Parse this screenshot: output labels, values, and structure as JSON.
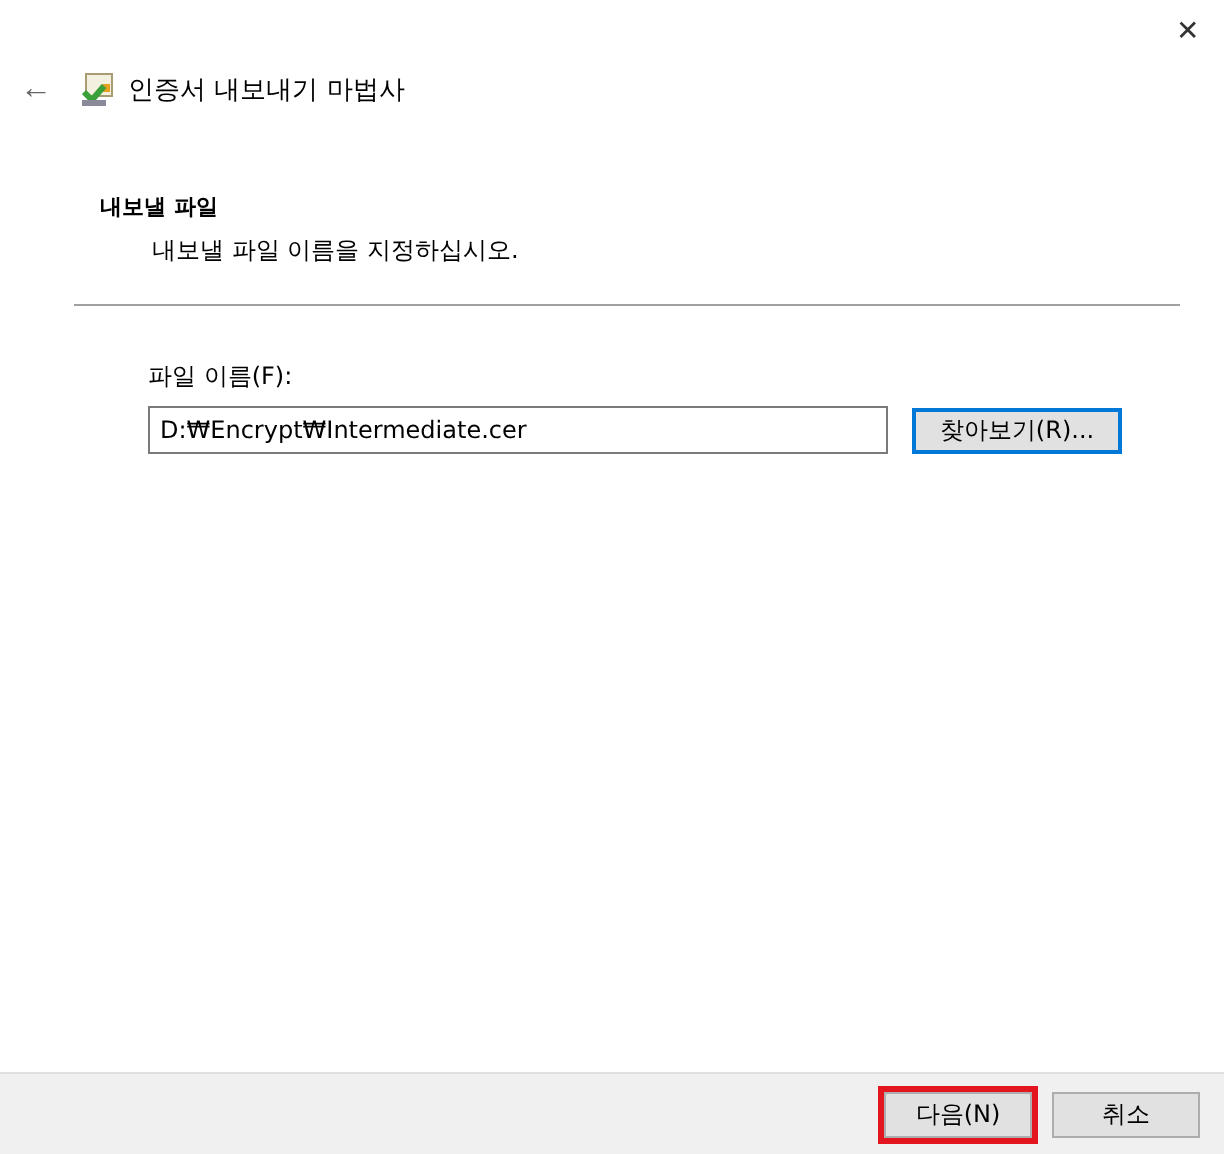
{
  "window": {
    "close": "✕",
    "back": "←",
    "title": "인증서 내보내기 마법사"
  },
  "header": {
    "title": "내보낼 파일",
    "subtitle": "내보낼 파일 이름을 지정하십시오."
  },
  "file_name": {
    "label": "파일 이름(F):",
    "value": "D:₩Encrypt₩Intermediate.cer"
  },
  "browse_button": {
    "label": "찾아보기(R)...",
    "focused": true
  },
  "buttons": [
    {
      "label": "다음(N)",
      "highlighted": true
    },
    {
      "label": "취소",
      "highlighted": false
    }
  ]
}
